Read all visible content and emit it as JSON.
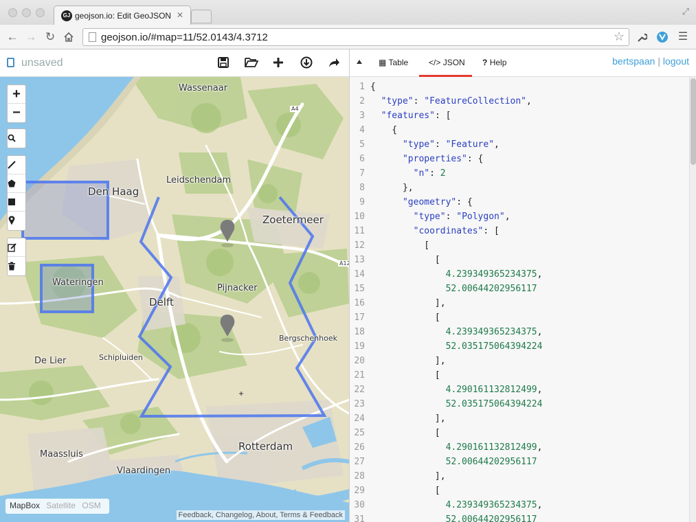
{
  "browser": {
    "tab_title": "geojson.io: Edit GeoJSON",
    "tab_favicon_text": "GJ",
    "url": "geojson.io/#map=11/52.0143/4.3712"
  },
  "app": {
    "doc_name": "unsaved",
    "tabs": [
      {
        "label": "Table",
        "icon": "table-icon"
      },
      {
        "label": "JSON",
        "icon": "code-icon",
        "active": true
      },
      {
        "label": "Help",
        "icon": "help-icon"
      }
    ],
    "user": {
      "name": "bertspaan",
      "separator": "|",
      "logout": "logout"
    },
    "header_actions": [
      "save-icon",
      "open-icon",
      "new-icon",
      "download-icon",
      "share-icon"
    ]
  },
  "map": {
    "labels": {
      "wassenaar": "Wassenaar",
      "den_haag": "Den Haag",
      "leidschendam": "Leidschendam",
      "zoetermeer": "Zoetermeer",
      "wateringen": "Wateringen",
      "pijnacker": "Pijnacker",
      "delft": "Delft",
      "bergschenhoek": "Bergschenhoek",
      "de_lier": "De Lier",
      "schipluiden": "Schipluiden",
      "rotterdam": "Rotterdam",
      "maassluis": "Maassluis",
      "vlaardingen": "Vlaardingen",
      "a4": "A4",
      "a12": "A12"
    },
    "layers": [
      "MapBox",
      "Satellite",
      "OSM"
    ],
    "active_layer": "MapBox",
    "attribution": "Feedback, Changelog, About, Terms & Feedback",
    "colors": {
      "land": "#e6e1c4",
      "green": "#b9cf8e",
      "water": "#8ec6ea",
      "road": "#ffffff",
      "draw": "#4b74f0"
    }
  },
  "editor": {
    "lines": [
      [
        [
          "p",
          "{"
        ]
      ],
      [
        [
          "p",
          "  "
        ],
        [
          "k",
          "\"type\""
        ],
        [
          "p",
          ": "
        ],
        [
          "s",
          "\"FeatureCollection\""
        ],
        [
          "p",
          ","
        ]
      ],
      [
        [
          "p",
          "  "
        ],
        [
          "k",
          "\"features\""
        ],
        [
          "p",
          ": ["
        ]
      ],
      [
        [
          "p",
          "    {"
        ]
      ],
      [
        [
          "p",
          "      "
        ],
        [
          "k",
          "\"type\""
        ],
        [
          "p",
          ": "
        ],
        [
          "s",
          "\"Feature\""
        ],
        [
          "p",
          ","
        ]
      ],
      [
        [
          "p",
          "      "
        ],
        [
          "k",
          "\"properties\""
        ],
        [
          "p",
          ": {"
        ]
      ],
      [
        [
          "p",
          "        "
        ],
        [
          "k",
          "\"n\""
        ],
        [
          "p",
          ": "
        ],
        [
          "n",
          "2"
        ]
      ],
      [
        [
          "p",
          "      },"
        ]
      ],
      [
        [
          "p",
          "      "
        ],
        [
          "k",
          "\"geometry\""
        ],
        [
          "p",
          ": {"
        ]
      ],
      [
        [
          "p",
          "        "
        ],
        [
          "k",
          "\"type\""
        ],
        [
          "p",
          ": "
        ],
        [
          "s",
          "\"Polygon\""
        ],
        [
          "p",
          ","
        ]
      ],
      [
        [
          "p",
          "        "
        ],
        [
          "k",
          "\"coordinates\""
        ],
        [
          "p",
          ": ["
        ]
      ],
      [
        [
          "p",
          "          ["
        ]
      ],
      [
        [
          "p",
          "            ["
        ]
      ],
      [
        [
          "p",
          "              "
        ],
        [
          "n",
          "4.239349365234375"
        ],
        [
          "p",
          ","
        ]
      ],
      [
        [
          "p",
          "              "
        ],
        [
          "n",
          "52.00644202956117"
        ]
      ],
      [
        [
          "p",
          "            ],"
        ]
      ],
      [
        [
          "p",
          "            ["
        ]
      ],
      [
        [
          "p",
          "              "
        ],
        [
          "n",
          "4.239349365234375"
        ],
        [
          "p",
          ","
        ]
      ],
      [
        [
          "p",
          "              "
        ],
        [
          "n",
          "52.035175064394224"
        ]
      ],
      [
        [
          "p",
          "            ],"
        ]
      ],
      [
        [
          "p",
          "            ["
        ]
      ],
      [
        [
          "p",
          "              "
        ],
        [
          "n",
          "4.290161132812499"
        ],
        [
          "p",
          ","
        ]
      ],
      [
        [
          "p",
          "              "
        ],
        [
          "n",
          "52.035175064394224"
        ]
      ],
      [
        [
          "p",
          "            ],"
        ]
      ],
      [
        [
          "p",
          "            ["
        ]
      ],
      [
        [
          "p",
          "              "
        ],
        [
          "n",
          "4.290161132812499"
        ],
        [
          "p",
          ","
        ]
      ],
      [
        [
          "p",
          "              "
        ],
        [
          "n",
          "52.00644202956117"
        ]
      ],
      [
        [
          "p",
          "            ],"
        ]
      ],
      [
        [
          "p",
          "            ["
        ]
      ],
      [
        [
          "p",
          "              "
        ],
        [
          "n",
          "4.239349365234375"
        ],
        [
          "p",
          ","
        ]
      ],
      [
        [
          "p",
          "              "
        ],
        [
          "n",
          "52.00644202956117"
        ]
      ]
    ]
  }
}
